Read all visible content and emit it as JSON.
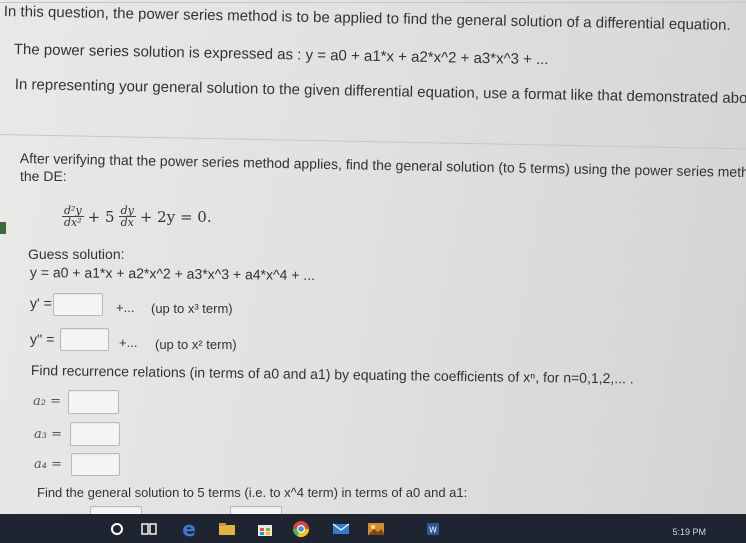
{
  "intro": {
    "line1": "In this question, the power series method is to be applied to find the general solution of a differential equation.",
    "line2": "The power series solution is expressed as : y = a0 + a1*x + a2*x^2 + a3*x^3 + ...",
    "line3": "In representing your general solution to the given differential equation, use a format like that demonstrated above."
  },
  "question": {
    "prompt_line1": "After verifying that the power series method applies, find the general solution (to 5 terms) using the power series method to",
    "prompt_line2": "the DE:",
    "de": {
      "d2y": "d²y",
      "dx2": "dx²",
      "plus5": "+ 5",
      "dy": "dy",
      "dx": "dx",
      "rest": "+ 2y = 0."
    },
    "guess_label": "Guess solution:",
    "guess_expr": "y = a0 + a1*x + a2*x^2 + a3*x^3 + a4*x^4 + ...",
    "yprime_label": "y' =",
    "yprime_suffix": "+...",
    "yprime_hint": "(up to x³ term)",
    "ydouble_label": "y'' =",
    "ydouble_suffix": "+...",
    "ydouble_hint": "(up to x² term)",
    "recurrence_prompt": "Find recurrence relations (in terms of a0 and a1) by equating the coefficients of xⁿ, for n=0,1,2,... .",
    "a2_label": "a₂ =",
    "a3_label": "a₃ =",
    "a4_label": "a₄ =",
    "general_prompt": "Find the general solution to 5 terms (i.e. to x^4 term) in terms of a0 and a1:"
  },
  "taskbar": {
    "clock": "5:19 PM",
    "icons": [
      "cortana-icon",
      "task-view-icon",
      "edge-icon",
      "file-explorer-icon",
      "store-icon",
      "chrome-icon",
      "mail-icon",
      "photos-icon",
      "word-icon"
    ]
  },
  "colors": {
    "taskbar": "#1e2530",
    "edge": "#3a7bd5",
    "chrome_red": "#d9473b",
    "word": "#2b5797"
  }
}
